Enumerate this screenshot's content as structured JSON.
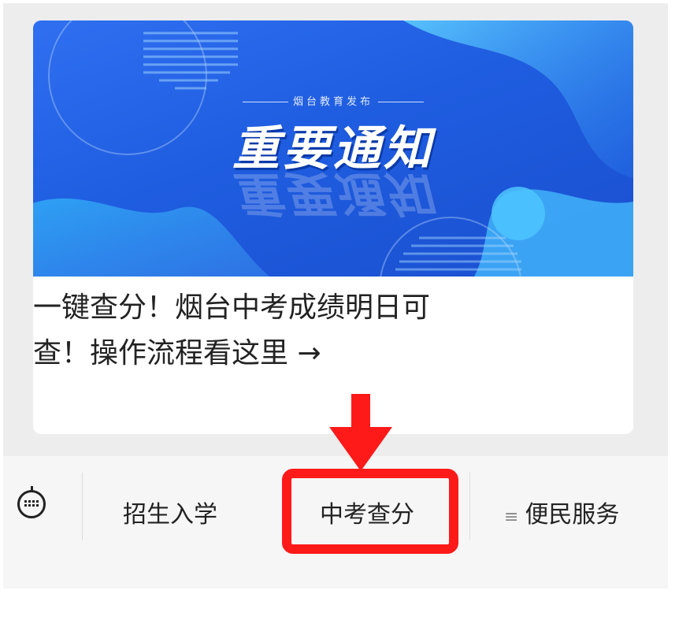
{
  "banner": {
    "subtitle": "烟台教育发布",
    "title": "重要通知"
  },
  "article": {
    "headline_line1": "一键查分！烟台中考成绩明日可",
    "headline_line2": "查！操作流程看这里 →"
  },
  "menu": {
    "items": [
      {
        "label": "招生入学"
      },
      {
        "label": "中考查分",
        "highlighted": true
      },
      {
        "label": "便民服务",
        "icon": "menu-lines-icon"
      }
    ]
  },
  "annotation": {
    "color": "#ff1a1a",
    "type": "arrow-and-box"
  }
}
